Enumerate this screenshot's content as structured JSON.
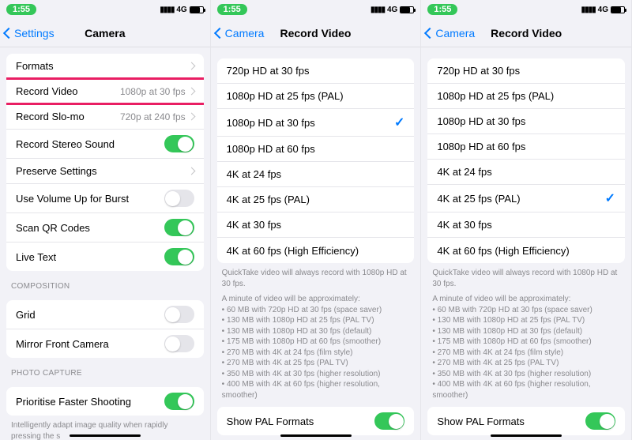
{
  "status": {
    "time": "1:55",
    "network": "4G"
  },
  "screen1": {
    "back": "Settings",
    "title": "Camera",
    "rows": {
      "formats": "Formats",
      "record_video": {
        "label": "Record Video",
        "detail": "1080p at 30 fps"
      },
      "record_slomo": {
        "label": "Record Slo-mo",
        "detail": "720p at 240 fps"
      },
      "stereo": "Record Stereo Sound",
      "preserve": "Preserve Settings",
      "volume_burst": "Use Volume Up for Burst",
      "scan_qr": "Scan QR Codes",
      "live_text": "Live Text",
      "grid": "Grid",
      "mirror": "Mirror Front Camera",
      "prioritise": "Prioritise Faster Shooting"
    },
    "groups": {
      "composition": "COMPOSITION",
      "photo_capture": "PHOTO CAPTURE"
    },
    "footnote": "Intelligently adapt image quality when rapidly pressing the s"
  },
  "video": {
    "back": "Camera",
    "title": "Record Video",
    "options": [
      "720p HD at 30 fps",
      "1080p HD at 25 fps (PAL)",
      "1080p HD at 30 fps",
      "1080p HD at 60 fps",
      "4K at 24 fps",
      "4K at 25 fps (PAL)",
      "4K at 30 fps",
      "4K at 60 fps (High Efficiency)"
    ],
    "selected_screen2": "1080p HD at 30 fps",
    "selected_screen3": "4K at 25 fps (PAL)",
    "quicktake_note": "QuickTake video will always record with 1080p HD at 30 fps.",
    "approx_heading": "A minute of video will be approximately:",
    "approx_lines": [
      "60 MB with 720p HD at 30 fps (space saver)",
      "130 MB with 1080p HD at 25 fps (PAL TV)",
      "130 MB with 1080p HD at 30 fps (default)",
      "175 MB with 1080p HD at 60 fps (smoother)",
      "270 MB with 4K at 24 fps (film style)",
      "270 MB with 4K at 25 fps (PAL TV)",
      "350 MB with 4K at 30 fps (higher resolution)",
      "400 MB with 4K at 60 fps (higher resolution, smoother)"
    ],
    "show_pal": "Show PAL Formats"
  }
}
